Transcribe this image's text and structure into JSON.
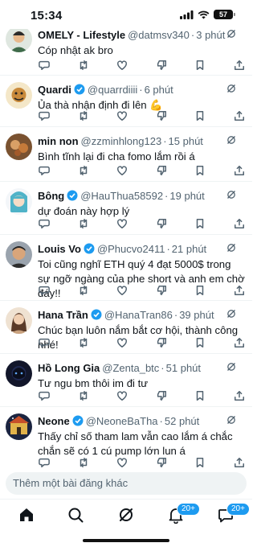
{
  "status_bar": {
    "time": "15:34",
    "battery": "57"
  },
  "colors": {
    "accent": "#1d9bf0",
    "text": "#0f1419",
    "muted": "#536471"
  },
  "posts": [
    {
      "name": "OMELY - Lifestyle",
      "verified": false,
      "handle": "@datmsv340",
      "time": "3 phút",
      "text": "Cóp nhật ak bro"
    },
    {
      "name": "Quardi",
      "verified": true,
      "handle": "@quarrdiiii",
      "time": "6 phút",
      "text": "Ủa thà nhận định đi lên 💪"
    },
    {
      "name": "min non",
      "verified": false,
      "handle": "@zzminhlong123",
      "time": "15 phút",
      "text": "Bình tĩnh lại đi cha fomo lắm rồi á"
    },
    {
      "name": "Bông",
      "verified": true,
      "handle": "@HauThua58592",
      "time": "19 phút",
      "text": "dự đoán này hợp lý"
    },
    {
      "name": "Louis Vo",
      "verified": true,
      "handle": "@Phucvo2411",
      "time": "21 phút",
      "text": "Toi cũng nghĩ ETH quý 4 đạt 5000$ trong sự ngỡ ngàng của phe short và anh em chờ đáy!!"
    },
    {
      "name": "Hana Trần",
      "verified": true,
      "handle": "@HanaTran86",
      "time": "39 phút",
      "text": "Chúc bạn luôn nắm bắt cơ hội, thành công nhé!"
    },
    {
      "name": "Hồ Long Gia",
      "verified": false,
      "handle": "@Zenta_btc",
      "time": "51 phút",
      "text": "Tư ngu bm thôi im đi tư"
    },
    {
      "name": "Neone",
      "verified": true,
      "handle": "@NeoneBaTha",
      "time": "52 phút",
      "text": "Thấy chỉ số tham lam vẫn cao lắm á chắc chắn sẽ có 1 cú pump lớn lun á"
    }
  ],
  "reply_placeholder": "Thêm một bài đăng khác",
  "tab_bar": {
    "items": [
      "home-icon",
      "search-icon",
      "grok-icon",
      "notifications-icon",
      "messages-icon"
    ],
    "notifications_badge": "20+",
    "messages_badge": "20+"
  }
}
